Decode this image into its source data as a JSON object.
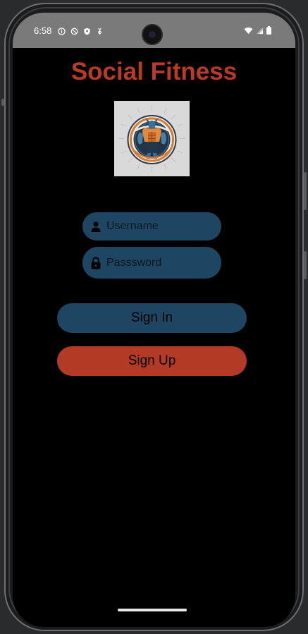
{
  "status_bar": {
    "time": "6:58",
    "left_icons": [
      "info-icon",
      "no-sync-icon",
      "shield-icon",
      "data-saver-icon"
    ],
    "right_icons": [
      "wifi-icon",
      "signal-icon",
      "battery-icon"
    ]
  },
  "app": {
    "title": "Social Fitness",
    "title_color": "#b93a27",
    "logo_alt": "fitness-athlete-emblem"
  },
  "form": {
    "username_placeholder": "Username",
    "password_placeholder": "Passsword",
    "field_color": "#1e4662"
  },
  "buttons": {
    "sign_in": "Sign In",
    "sign_up": "Sign Up",
    "sign_in_color": "#1e4662",
    "sign_up_color": "#b33a24"
  }
}
